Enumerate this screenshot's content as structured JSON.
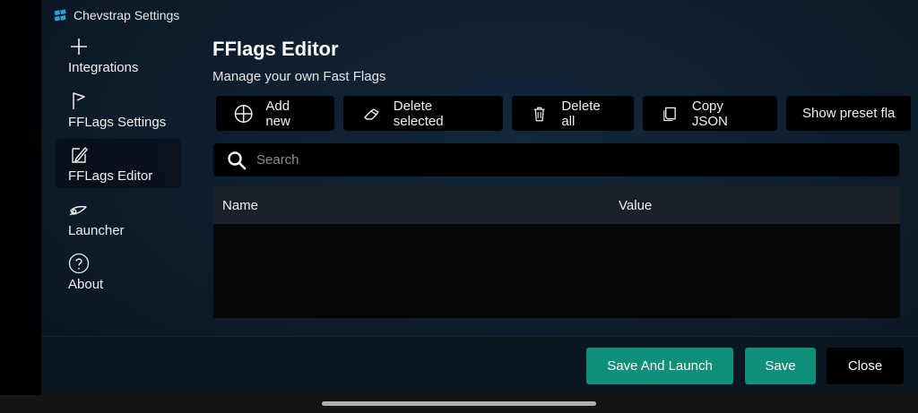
{
  "app": {
    "title": "Chevstrap Settings"
  },
  "sidebar": {
    "items": [
      {
        "label": "Integrations",
        "icon": "plus-icon"
      },
      {
        "label": "FFLags Settings",
        "icon": "flag-icon"
      },
      {
        "label": "FFLags Editor",
        "icon": "edit-icon",
        "active": true
      },
      {
        "label": "Launcher",
        "icon": "rocket-icon"
      },
      {
        "label": "About",
        "icon": "help-circle-icon"
      }
    ]
  },
  "page": {
    "title": "FFlags Editor",
    "subtitle": "Manage your own Fast Flags"
  },
  "toolbar": {
    "add_new": "Add new",
    "delete_selected": "Delete selected",
    "delete_all": "Delete all",
    "copy_json": "Copy JSON",
    "show_preset": "Show preset fla"
  },
  "search": {
    "placeholder": "Search",
    "value": ""
  },
  "table": {
    "columns": [
      "Name",
      "Value"
    ],
    "rows": []
  },
  "footer": {
    "save_and_launch": "Save And Launch",
    "save": "Save",
    "close": "Close"
  },
  "colors": {
    "accent": "#0f8f7a",
    "background": "#0f1e2f",
    "header": "#1a2129"
  }
}
